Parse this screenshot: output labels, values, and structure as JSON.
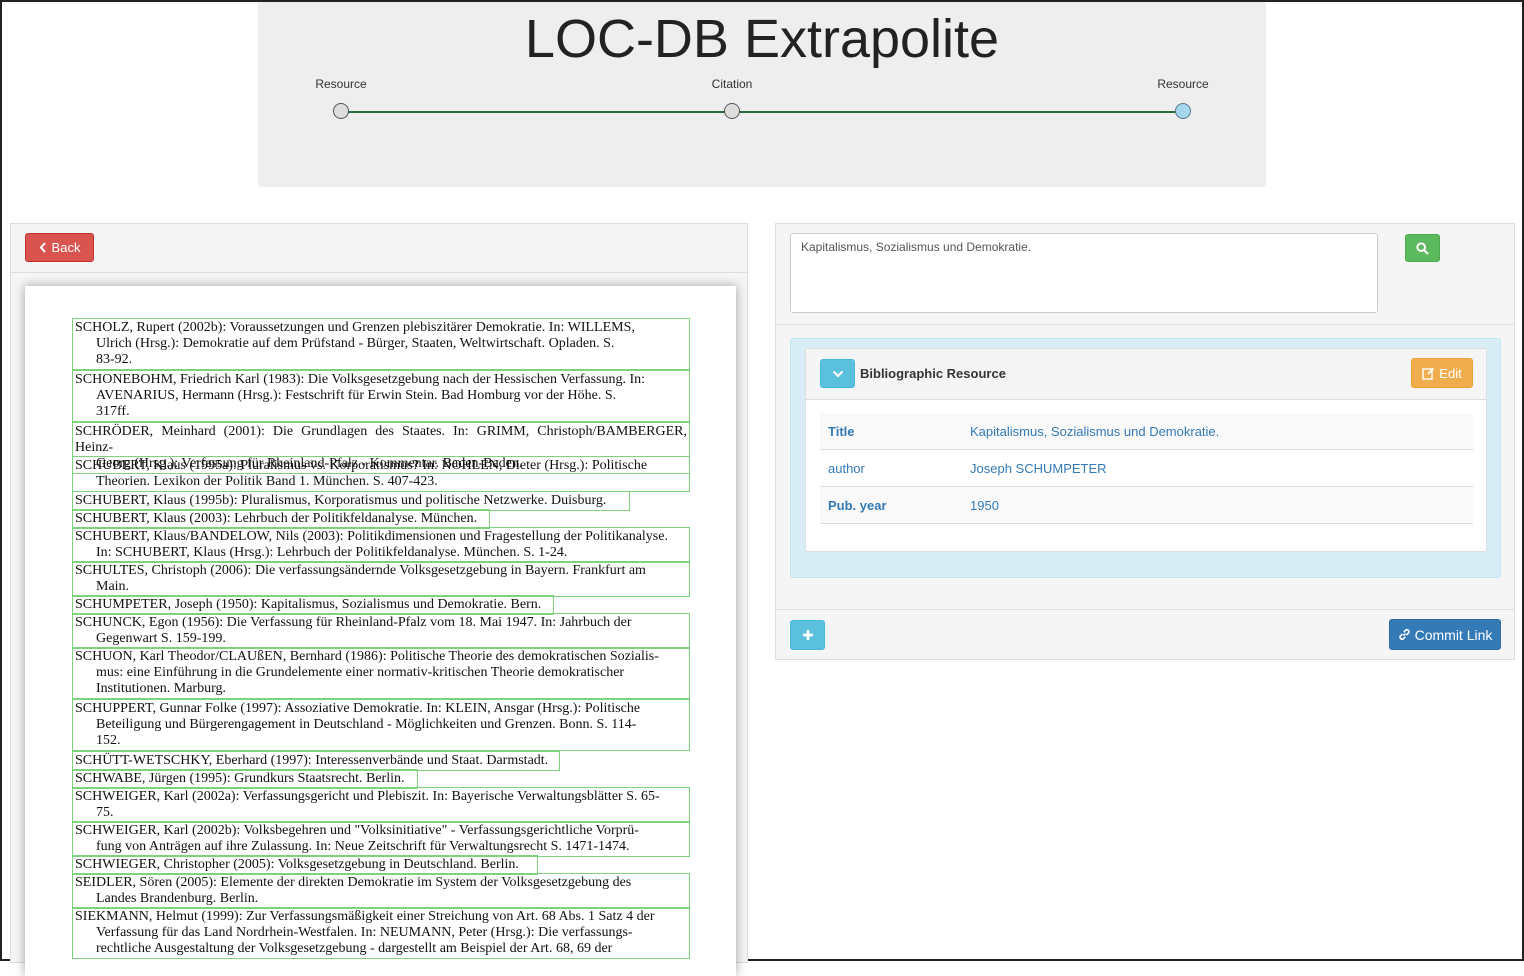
{
  "header": {
    "title": "LOC-DB Extrapolite",
    "steps": [
      {
        "label": "Resource",
        "active": false
      },
      {
        "label": "Citation",
        "active": false
      },
      {
        "label": "Resource",
        "active": true
      }
    ]
  },
  "left_panel": {
    "back_label": "Back",
    "back_icon": "chevron-left-icon",
    "document_lines": [
      "SCHOLZ, Rupert (2002b): Voraussetzungen und Grenzen plebiszitärer Demokratie. In: WILLEMS,\n      Ulrich (Hrsg.): Demokratie auf dem Prüfstand - Bürger, Staaten, Weltwirtschaft. Opladen. S.\n      83-92.",
      "SCHONEBOHM, Friedrich Karl (1983): Die Volksgesetzgebung nach der Hessischen Verfassung. In:\n      AVENARIUS, Hermann (Hrsg.): Festschrift für Erwin Stein. Bad Homburg vor der Höhe. S.\n      317ff.",
      "SCHRÖDER, Meinhard (2001): Die Grundlagen des Staates. In: GRIMM, Christoph/BAMBERGER, Heinz-\n      Georg (Hrsg.): Verfassung für Rheinland-Pfalz - Kommentar. Baden-Baden.",
      "SCHUBERT, Klaus (1995a): Pluralismus vs. Korporatismus? In: NOHLEN, Dieter (Hrsg.): Politische\n      Theorien. Lexikon der Politik Band 1. München. S. 407-423.",
      "SCHUBERT, Klaus (1995b): Pluralismus, Korporatismus und politische Netzwerke. Duisburg.",
      "SCHUBERT, Klaus (2003): Lehrbuch der Politikfeldanalyse. München.",
      "SCHUBERT, Klaus/BANDELOW, Nils (2003): Politikdimensionen und Fragestellung der Politikanalyse.\n      In: SCHUBERT, Klaus (Hrsg.): Lehrbuch der Politikfeldanalyse. München. S. 1-24.",
      "SCHULTES, Christoph (2006): Die verfassungsändernde Volksgesetzgebung in Bayern. Frankfurt am\n      Main.",
      "SCHUMPETER, Joseph (1950): Kapitalismus, Sozialismus und Demokratie. Bern.",
      "SCHUNCK, Egon (1956): Die Verfassung für Rheinland-Pfalz vom 18. Mai 1947. In: Jahrbuch der\n      Gegenwart S. 159-199.",
      "SCHUON, Karl Theodor/CLAUßEN, Bernhard (1986): Politische Theorie des demokratischen Sozialis-\n      mus: eine Einführung in die Grundelemente einer normativ-kritischen Theorie demokratischer\n      Institutionen. Marburg.",
      "SCHUPPERT, Gunnar Folke (1997): Assoziative Demokratie. In: KLEIN, Ansgar (Hrsg.): Politische\n      Beteiligung und Bürgerengagement in Deutschland - Möglichkeiten und Grenzen. Bonn. S. 114-\n      152.",
      "SCHÜTT-WETSCHKY, Eberhard (1997): Interessenverbände und Staat. Darmstadt.",
      "SCHWABE, Jürgen (1995): Grundkurs Staatsrecht. Berlin.",
      "SCHWEIGER, Karl (2002a): Verfassungsgericht und Plebiszit. In: Bayerische Verwaltungsblätter S. 65-\n      75.",
      "SCHWEIGER, Karl (2002b): Volksbegehren und \"Volksinitiative\" - Verfassungsgerichtliche Vorprü-\n      fung von Anträgen auf ihre Zulassung. In: Neue Zeitschrift für Verwaltungsrecht S. 1471-1474.",
      "SCHWIEGER, Christopher (2005): Volksgesetzgebung in Deutschland. Berlin.",
      "SEIDLER, Sören (2005): Elemente der direkten Demokratie im System der Volksgesetzgebung des\n      Landes Brandenburg. Berlin.",
      "SIEKMANN, Helmut (1999): Zur Verfassungsmäßigkeit einer Streichung von Art. 68 Abs. 1 Satz 4 der\n      Verfassung für das Land Nordrhein-Westfalen. In: NEUMANN, Peter (Hrsg.): Die verfassungs-\n      rechtliche Ausgestaltung der Volksgesetzgebung - dargestellt am Beispiel der Art. 68, 69 der"
    ]
  },
  "right_panel": {
    "search_value": "Kapitalismus, Sozialismus und Demokratie.",
    "search_icon": "search-icon",
    "card": {
      "title": "Bibliographic Resource",
      "toggle_icon": "chevron-down-icon",
      "edit_label": "Edit",
      "edit_icon": "edit-icon",
      "rows": [
        {
          "key": "Title",
          "value": "Kapitalismus, Sozialismus und Demokratie."
        },
        {
          "key": "author",
          "value": "Joseph SCHUMPETER"
        },
        {
          "key": "Pub. year",
          "value": "1950"
        }
      ]
    },
    "add_icon": "plus-icon",
    "commit_label": "Commit Link",
    "commit_icon": "link-icon"
  },
  "colors": {
    "danger": "#d9534f",
    "success": "#5cb85c",
    "info": "#5bc0de",
    "warning": "#f0ad4e",
    "primary": "#337ab7",
    "ocr_box": "#7cd37c",
    "step_active": "#a6d7ec"
  }
}
